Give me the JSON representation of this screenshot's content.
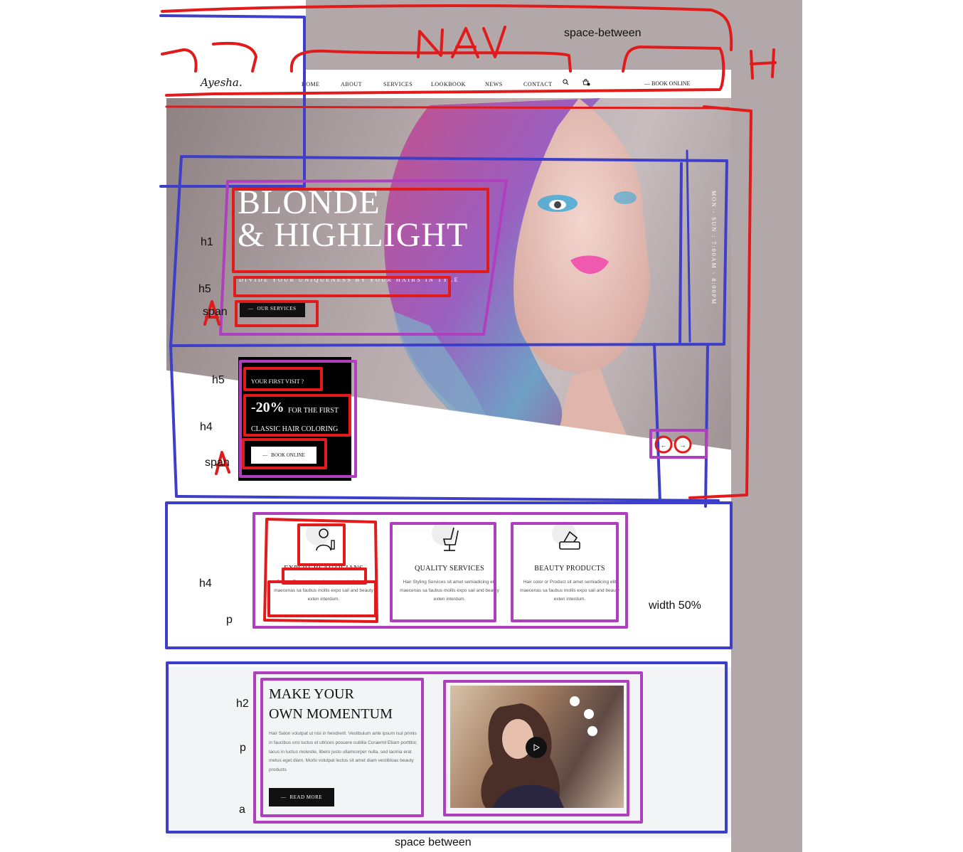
{
  "nav": {
    "logo": "Ayesha.",
    "items": [
      "HOME",
      "ABOUT",
      "SERVICES",
      "LOOKBOOK",
      "NEWS",
      "CONTACT"
    ],
    "book": "BOOK ONLINE"
  },
  "hero": {
    "title_line1": "BLONDE",
    "title_line2": "& HIGHLIGHT",
    "subtitle": "DIVIDE YOUR UNIQUENESS BY YOUR HAIRS IN TYLE",
    "cta": "OUR SERVICES",
    "hours": "MON - SUN : 7:00AM - 8:00PM"
  },
  "promo": {
    "heading": "YOUR FIRST VISIT ?",
    "percent": "-20%",
    "line1": "FOR THE FIRST",
    "line2": "CLASSIC HAIR COLORING",
    "cta": "BOOK ONLINE"
  },
  "slider": {
    "prev": "←",
    "next": "→"
  },
  "features": [
    {
      "title": "EXPERT BEAUTICIANS",
      "text": "Beauty Experts dolor sit amet semiadicing elit maecenas sa faubus mollis expo sail and beauty exten interdum."
    },
    {
      "title": "QUALITY SERVICES",
      "text": "Hair Styling Services sit amet semiadicing elit maecenas sa faubus mollis expo sail and beauty exten interdum."
    },
    {
      "title": "BEAUTY PRODUCTS",
      "text": "Hair color or Product sit amet semiadicing elit maecenas sa faubus mollis expo sail and beauty exten interdum."
    }
  ],
  "momentum": {
    "title_line1": "MAKE YOUR",
    "title_line2": "OWN MOMENTUM",
    "text": "Hair Salon volutpat ut nisl in hendrerit. Vestibulum ante ipsum isul primis in faucibus orci luctus et ultrices posuere cubilia Curaemil Etiam porttitor, lacus in luctus molestie, libero justo ullamcorper nulla, sed lacinia erat metus eget diam. Morbi volutpat lectus sit amet diam vestibloas beauty products",
    "cta": "READ MORE"
  },
  "annotations": {
    "space_between_top": "space-between",
    "nav": "NAV",
    "h_mark": "H",
    "h1": "h1",
    "h5_a": "h5",
    "span_a": "span",
    "a_a": "A",
    "h5_b": "h5",
    "h4_a": "h4",
    "span_b": "span",
    "a_b": "A",
    "h4_b": "h4",
    "p_a": "p",
    "width": "width 50%",
    "h2": "h2",
    "p_b": "p",
    "a_c": "a",
    "space_between_bottom": "space between"
  },
  "colors": {
    "annotation_red": "#e11b1b",
    "annotation_blue": "#3d3fc9",
    "annotation_purple": "#b03fbf",
    "dark": "#111111"
  }
}
